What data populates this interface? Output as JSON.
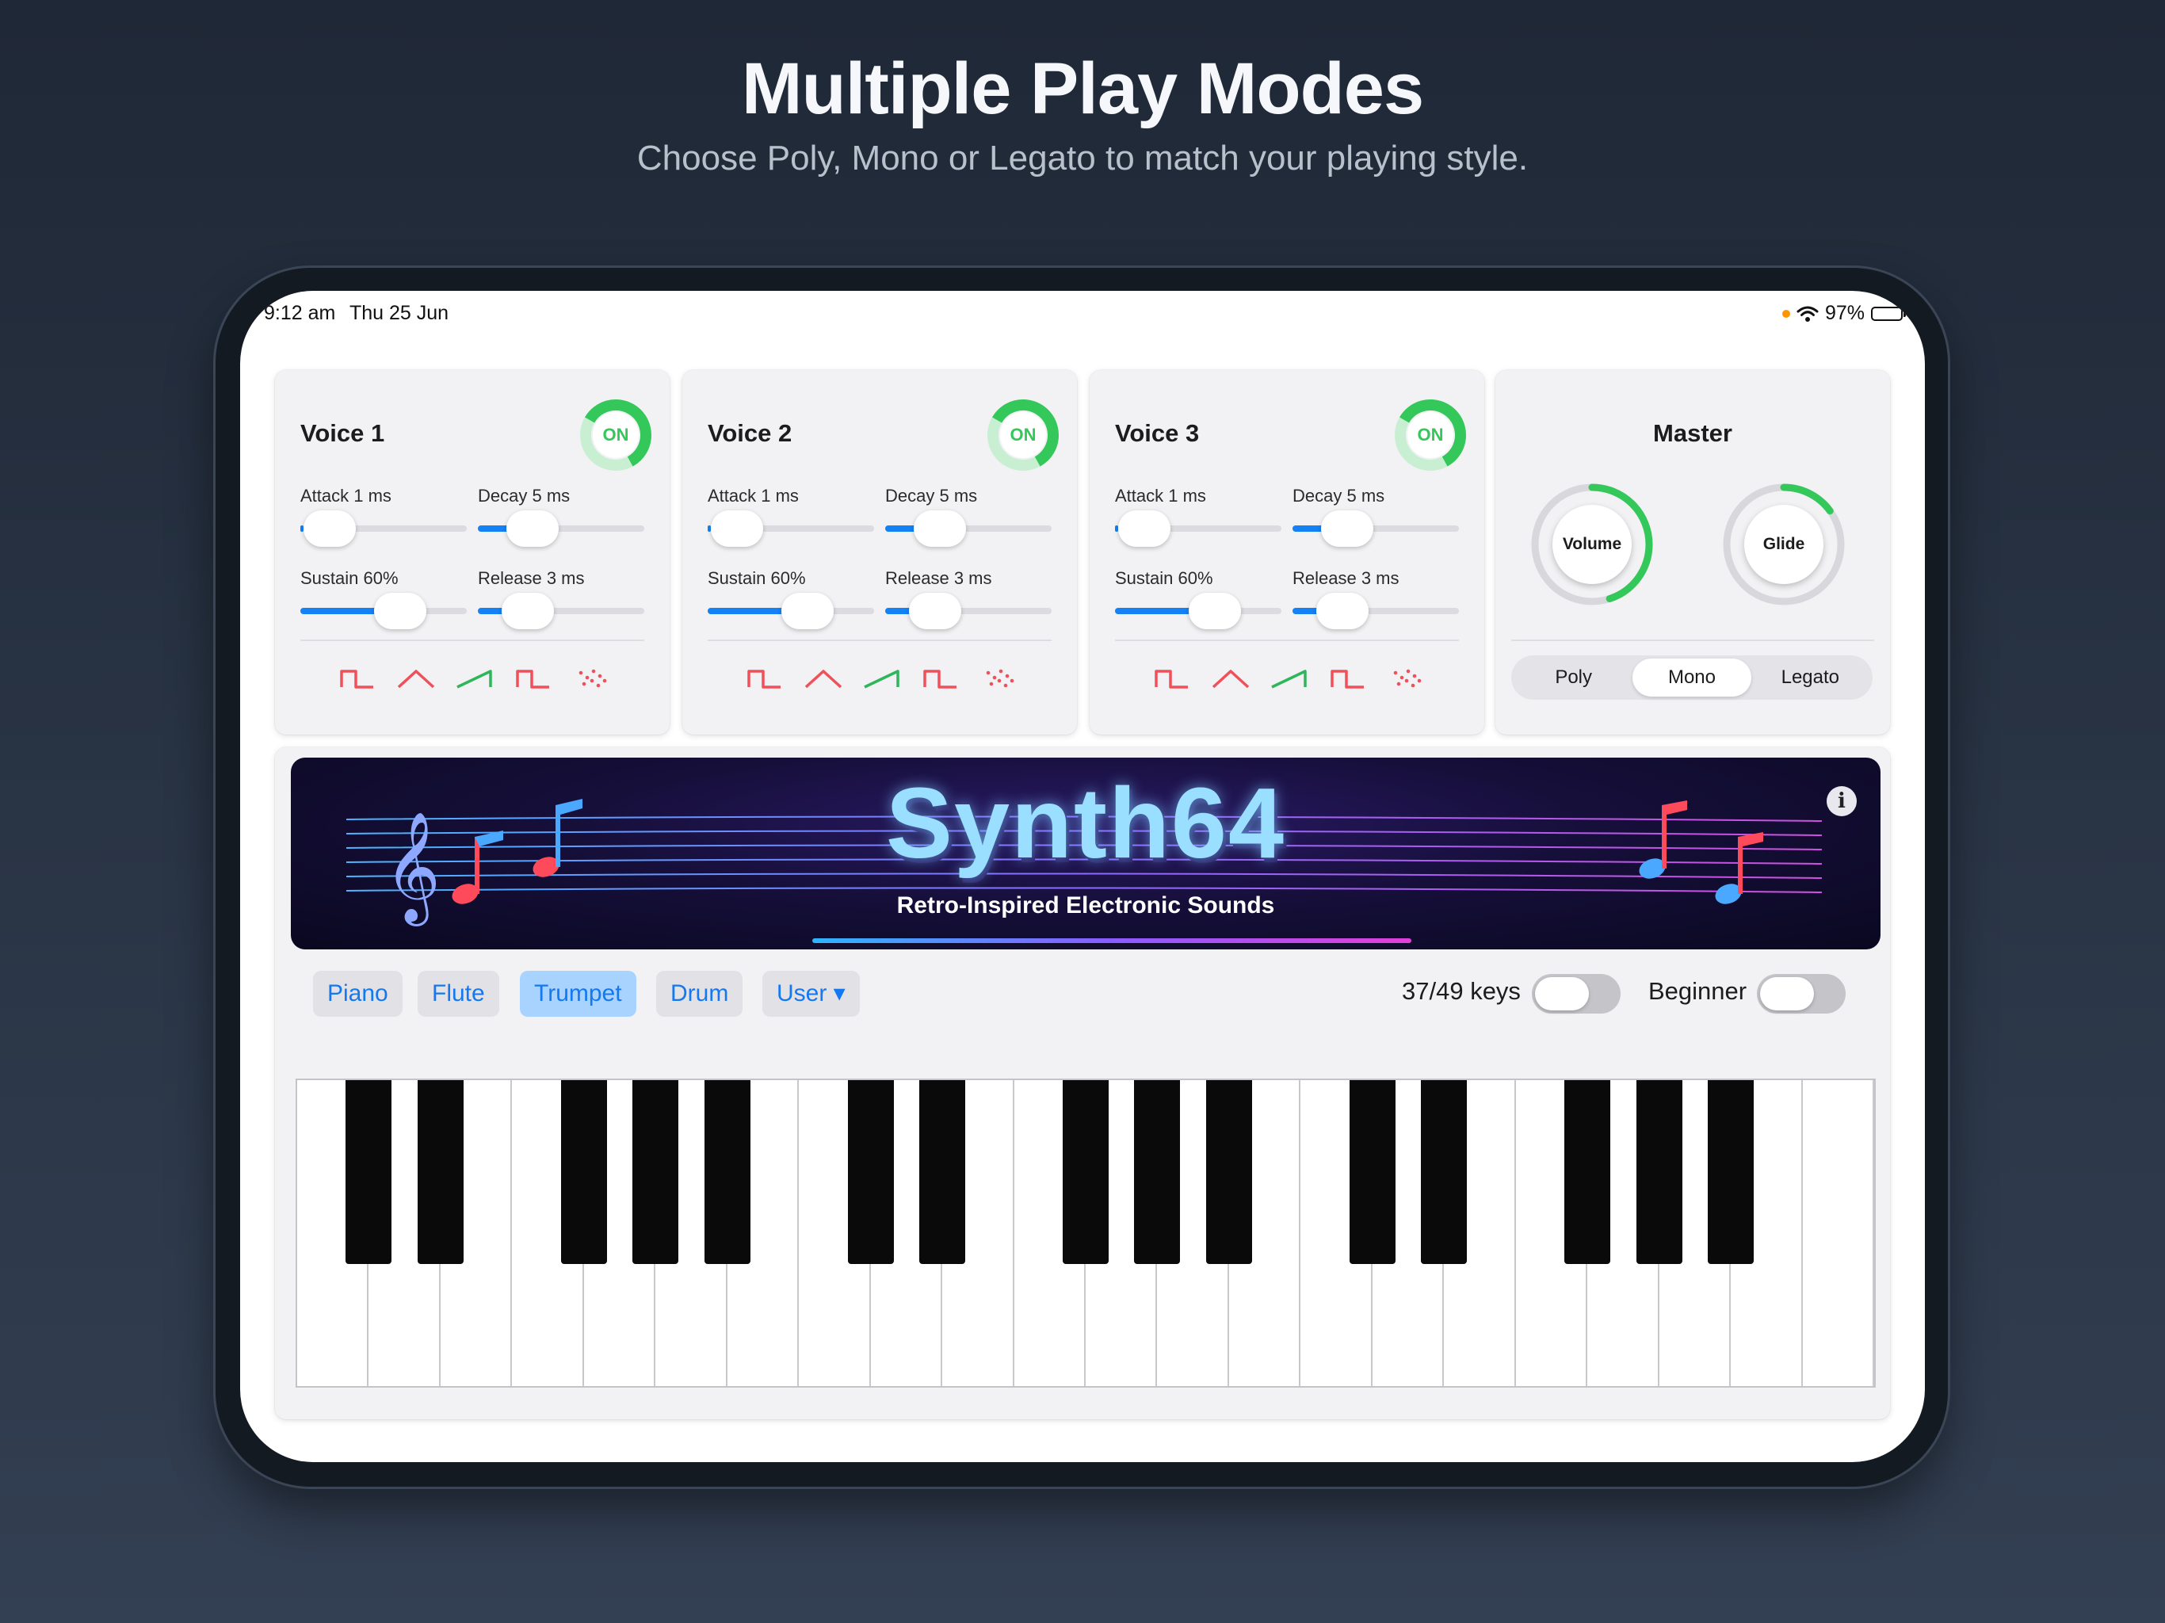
{
  "promo": {
    "title": "Multiple Play Modes",
    "subtitle": "Choose Poly, Mono or Legato to match your playing style."
  },
  "status_bar": {
    "time": "9:12 am",
    "date": "Thu 25 Jun",
    "battery": "97%"
  },
  "voices": [
    {
      "title": "Voice 1",
      "toggle": "ON",
      "attack": "Attack 1 ms",
      "decay": "Decay 5 ms",
      "sustain": "Sustain 60%",
      "release": "Release 3 ms"
    },
    {
      "title": "Voice 2",
      "toggle": "ON",
      "attack": "Attack 1 ms",
      "decay": "Decay 5 ms",
      "sustain": "Sustain 60%",
      "release": "Release 3 ms"
    },
    {
      "title": "Voice 3",
      "toggle": "ON",
      "attack": "Attack 1 ms",
      "decay": "Decay 5 ms",
      "sustain": "Sustain 60%",
      "release": "Release 3 ms"
    }
  ],
  "slider_levels": {
    "attack": 0.02,
    "decay": 0.33,
    "sustain": 0.6,
    "release": 0.3
  },
  "waveforms": [
    "pulse-wave-icon",
    "triangle-wave-icon",
    "sawtooth-wave-icon",
    "square-wave-icon",
    "noise-wave-icon"
  ],
  "master": {
    "title": "Master",
    "volume_label": "Volume",
    "glide_label": "Glide",
    "volume_level": 0.45,
    "glide_level": 0.15,
    "modes": [
      "Poly",
      "Mono",
      "Legato"
    ],
    "selected_mode": "Mono"
  },
  "banner": {
    "logo": "Synth64",
    "tagline": "Retro-Inspired Electronic Sounds"
  },
  "instruments": [
    "Piano",
    "Flute",
    "Trumpet",
    "Drum",
    "User ▾"
  ],
  "selected_instrument": "Trumpet",
  "keys_label": "37/49 keys",
  "beginner_label": "Beginner",
  "colors": {
    "accent_blue": "#1482f5",
    "on_green": "#34c759",
    "wave_red": "#f0505a",
    "wave_green": "#2fb65a"
  }
}
